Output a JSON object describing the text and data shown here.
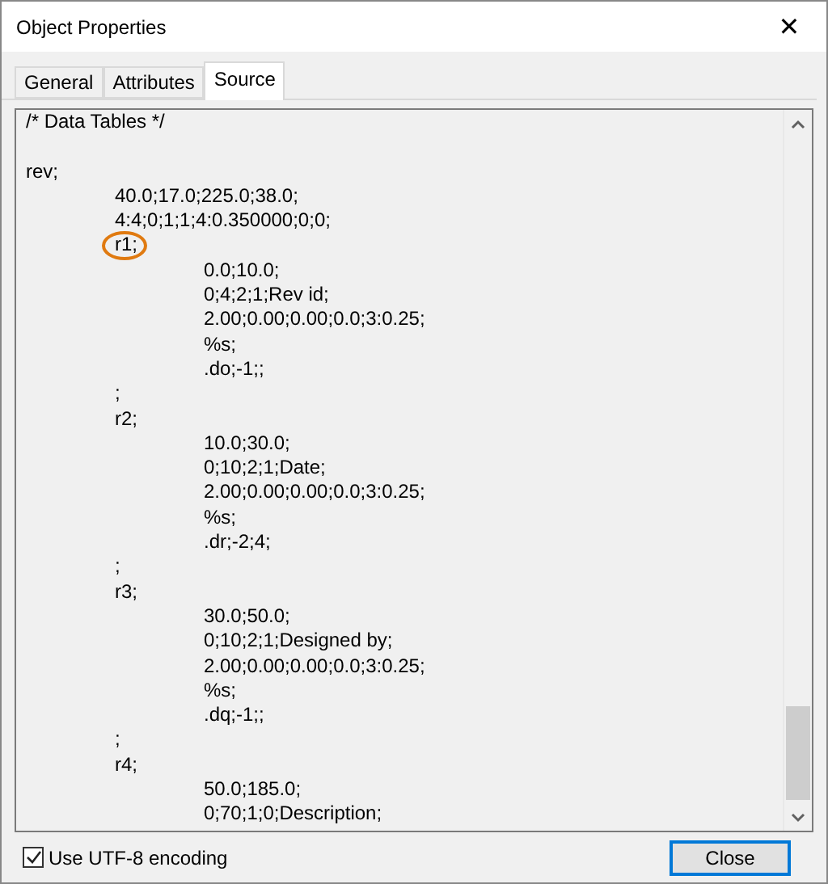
{
  "window": {
    "title": "Object Properties",
    "close_glyph": "✕"
  },
  "tabs": [
    {
      "label": "General",
      "selected": false
    },
    {
      "label": "Attributes",
      "selected": false
    },
    {
      "label": "Source",
      "selected": true
    }
  ],
  "source": {
    "lines": [
      {
        "kind": "comment",
        "text": "/* Data Tables */"
      },
      {
        "kind": "code",
        "text": "rev;",
        "children": [
          {
            "kind": "code",
            "text": "40.0;17.0;225.0;38.0;"
          },
          {
            "kind": "code",
            "text": "4:4;0;1;1;4:0.350000;0;0;"
          },
          {
            "kind": "code",
            "text": "r1;",
            "circled": true,
            "children": [
              {
                "kind": "code",
                "text": "0.0;10.0;"
              },
              {
                "kind": "code",
                "text": "0;4;2;1;Rev id;"
              },
              {
                "kind": "code",
                "text": "2.00;0.00;0.00;0.0;3:0.25;"
              },
              {
                "kind": "code",
                "text": "%s;"
              },
              {
                "kind": "code",
                "text": ".do;-1;;"
              }
            ]
          },
          {
            "kind": "code",
            "text": ";"
          },
          {
            "kind": "code",
            "text": "r2;",
            "circled": false,
            "children": [
              {
                "kind": "code",
                "text": "10.0;30.0;"
              },
              {
                "kind": "code",
                "text": "0;10;2;1;Date;"
              },
              {
                "kind": "code",
                "text": "2.00;0.00;0.00;0.0;3:0.25;"
              },
              {
                "kind": "code",
                "text": "%s;"
              },
              {
                "kind": "code",
                "text": ".dr;-2;4;"
              }
            ]
          },
          {
            "kind": "code",
            "text": ";"
          },
          {
            "kind": "code",
            "text": "r3;",
            "circled": false,
            "children": [
              {
                "kind": "code",
                "text": "30.0;50.0;"
              },
              {
                "kind": "code",
                "text": "0;10;2;1;Designed by;"
              },
              {
                "kind": "code",
                "text": "2.00;0.00;0.00;0.0;3:0.25;"
              },
              {
                "kind": "code",
                "text": "%s;"
              },
              {
                "kind": "code",
                "text": ".dq;-1;;"
              }
            ]
          },
          {
            "kind": "code",
            "text": ";"
          },
          {
            "kind": "code",
            "text": "r4;",
            "circled": false,
            "children": [
              {
                "kind": "code",
                "text": "50.0;185.0;"
              },
              {
                "kind": "code",
                "text": "0;70;1;0;Description;"
              }
            ]
          }
        ]
      }
    ]
  },
  "encoding": {
    "label": "Use UTF-8 encoding",
    "checked": true
  },
  "buttons": [
    {
      "label": "Close",
      "focused": true
    }
  ]
}
